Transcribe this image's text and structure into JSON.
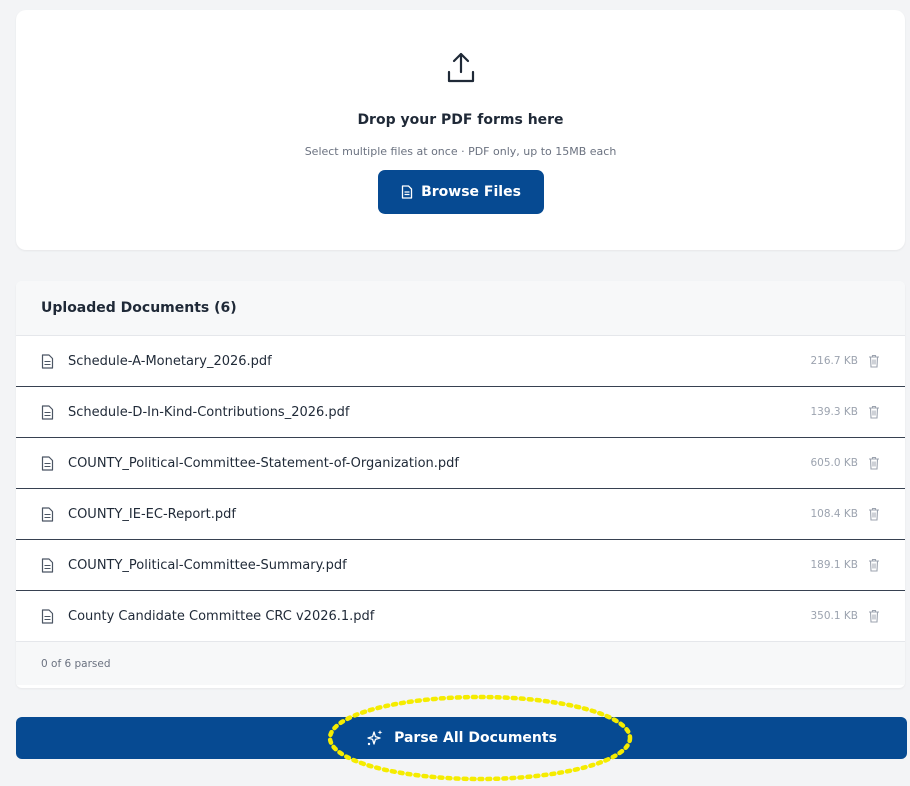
{
  "upload": {
    "icon": "upload-icon",
    "title": "Drop your PDF forms here",
    "subtitle": "Select multiple files at once · PDF only, up to 15MB each",
    "browse_label": "Browse Files",
    "browse_icon": "file-icon"
  },
  "documents": {
    "header": "Uploaded Documents (6)",
    "items": [
      {
        "name": "Schedule-A-Monetary_2026.pdf",
        "size": "216.7 KB"
      },
      {
        "name": "Schedule-D-In-Kind-Contributions_2026.pdf",
        "size": "139.3 KB"
      },
      {
        "name": "COUNTY_Political-Committee-Statement-of-Organization.pdf",
        "size": "605.0 KB"
      },
      {
        "name": "COUNTY_IE-EC-Report.pdf",
        "size": "108.4 KB"
      },
      {
        "name": "COUNTY_Political-Committee-Summary.pdf",
        "size": "189.1 KB"
      },
      {
        "name": "County Candidate Committee CRC v2026.1.pdf",
        "size": "350.1 KB"
      }
    ],
    "parsed_status": "0 of 6 parsed"
  },
  "parse_button": {
    "label": "Parse All Documents",
    "icon": "sparkles-icon"
  },
  "colors": {
    "primary": "#064a92",
    "highlight": "#f5ec00",
    "background": "#f3f4f6"
  }
}
